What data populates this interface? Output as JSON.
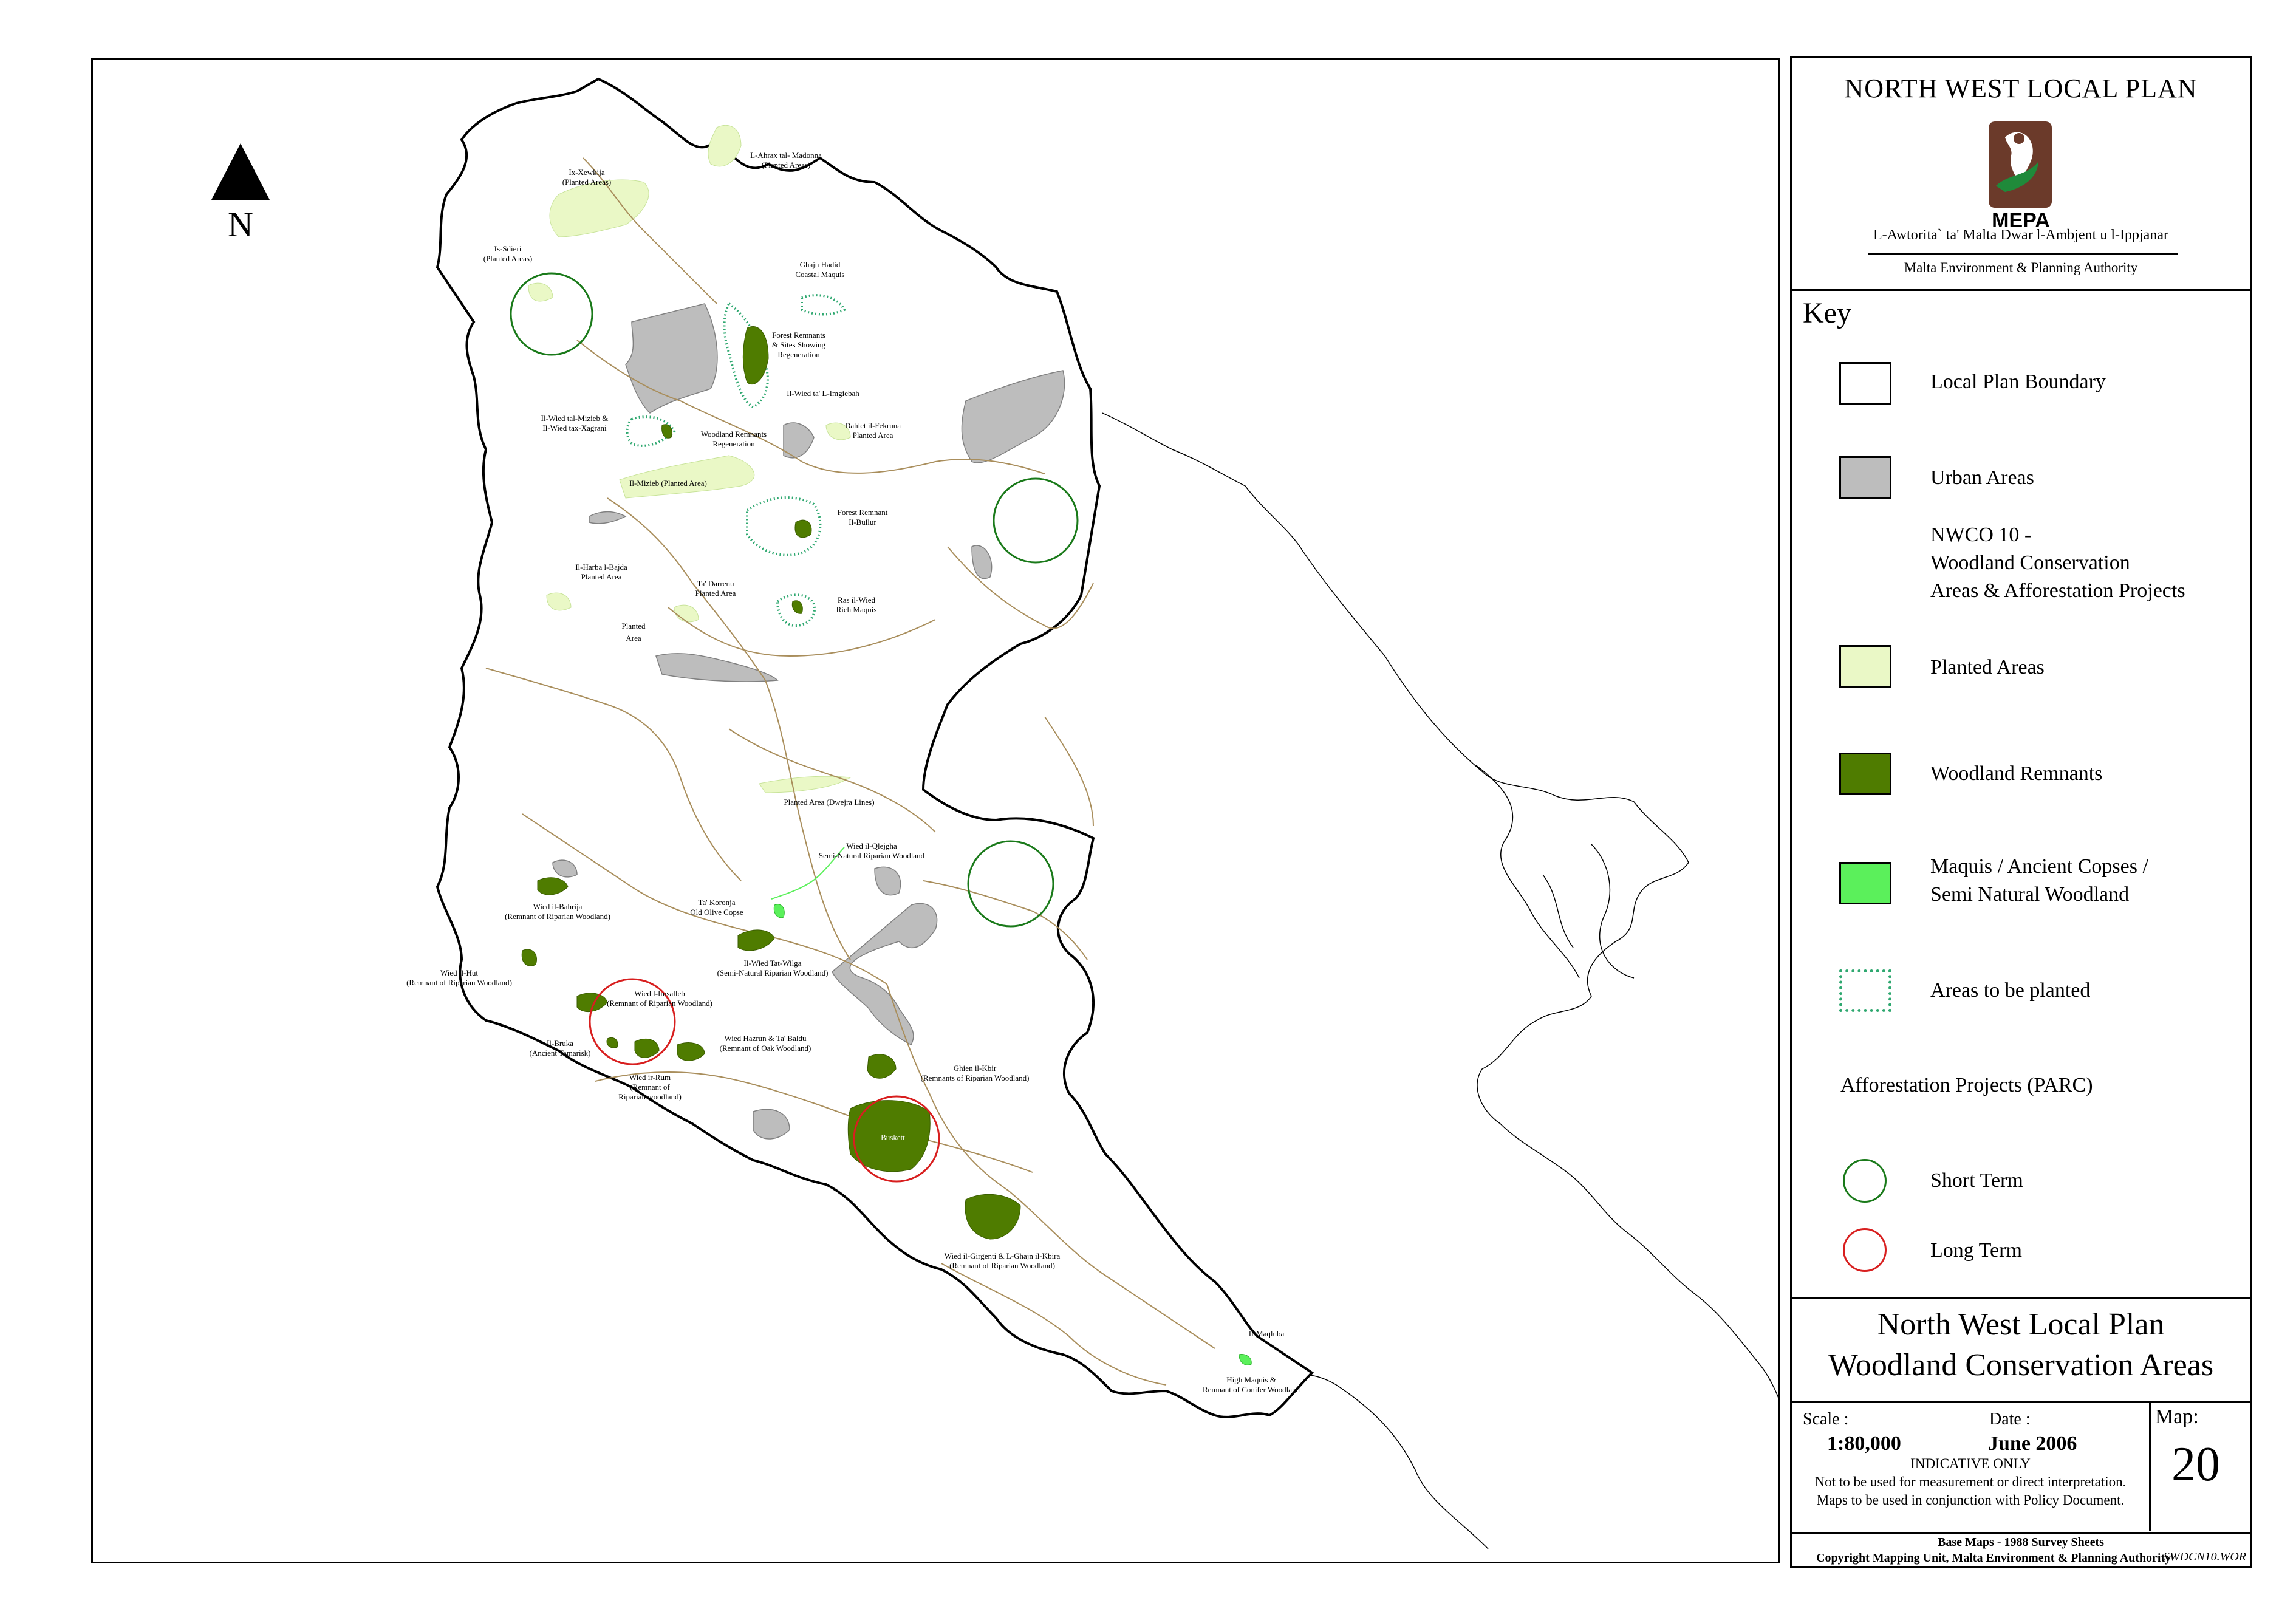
{
  "north_label": "N",
  "header": {
    "title": "NORTH WEST LOCAL PLAN",
    "logo_text": "MEPA",
    "authority_maltese": "L-Awtorita` ta' Malta Dwar l-Ambjent u l-Ippjanar",
    "authority_english": "Malta Environment & Planning Authority"
  },
  "key": {
    "title": "Key",
    "items": [
      {
        "label": "Local Plan Boundary",
        "fill": "#ffffff",
        "border": "#000000",
        "style": "solid"
      },
      {
        "label": "Urban Areas",
        "fill": "#bdbdbd",
        "border": "#000000",
        "style": "solid"
      },
      {
        "label": "NWCO 10 -",
        "fill": "",
        "border": "",
        "style": "none"
      },
      {
        "label": "Woodland Conservation",
        "fill": "",
        "border": "",
        "style": "none"
      },
      {
        "label": "Areas & Afforestation Projects",
        "fill": "",
        "border": "",
        "style": "none"
      },
      {
        "label": "Planted Areas",
        "fill": "#eaf8c6",
        "border": "#000000",
        "style": "solid"
      },
      {
        "label": "Woodland Remnants",
        "fill": "#4f7c00",
        "border": "#000000",
        "style": "solid"
      },
      {
        "label": "Maquis / Ancient Copses /",
        "fill": "#5bf05b",
        "border": "#000000",
        "style": "solid"
      },
      {
        "label": "Semi Natural Woodland",
        "fill": "",
        "border": "",
        "style": "none"
      },
      {
        "label": "Areas to be planted",
        "fill": "#ffffff",
        "border": "#2fa870",
        "style": "dotted"
      }
    ],
    "afforestation_title": "Afforestation Projects (PARC)",
    "short_term": {
      "label": "Short Term",
      "color": "#1a7a1a"
    },
    "long_term": {
      "label": "Long Term",
      "color": "#d81f1f"
    }
  },
  "plan_title": {
    "line1": "North West Local Plan",
    "line2": "Woodland Conservation Areas"
  },
  "info": {
    "scale_label": "Scale :",
    "scale_value": "1:80,000",
    "date_label": "Date :",
    "date_value": "June 2006",
    "map_label": "Map:",
    "map_number": "20",
    "indicative": "INDICATIVE ONLY",
    "note1": "Not to be used for measurement or direct interpretation.",
    "note2": "Maps to be used in conjunction with Policy Document."
  },
  "footer": {
    "base_maps": "Base Maps - 1988 Survey Sheets",
    "copyright": "Copyright Mapping Unit, Malta Environment & Planning Authority",
    "reference": "SWDCN10.WOR"
  },
  "map_labels": [
    {
      "id": "ix-xewkija",
      "lines": [
        "Ix-Xewkija",
        "(Planted Areas)"
      ]
    },
    {
      "id": "l-ahrax",
      "lines": [
        "L-Ahrax tal- Madonna",
        "(Planted Areas)"
      ]
    },
    {
      "id": "is-sdieri",
      "lines": [
        "Is-Sdieri",
        "(Planted Areas)"
      ]
    },
    {
      "id": "ghajn-hadid",
      "lines": [
        "Ghajn Hadid",
        "Coastal Maquis"
      ]
    },
    {
      "id": "forest-remnants",
      "lines": [
        "Forest Remnants",
        "& Sites Showing",
        "Regeneration"
      ]
    },
    {
      "id": "il-wied-ta-l-imgiebah",
      "lines": [
        "Il-Wied ta' L-Imgiebah"
      ]
    },
    {
      "id": "il-wied-tal-mizieb",
      "lines": [
        "Il-Wied tal-Mizieb &",
        "Il-Wied tax-Xagrani"
      ]
    },
    {
      "id": "woodland-remnants-regen",
      "lines": [
        "Woodland Remnants",
        "Regeneration"
      ]
    },
    {
      "id": "dahlet-il-fekruna",
      "lines": [
        "Dahlet il-Fekruna",
        "Planted Area"
      ]
    },
    {
      "id": "il-mizieb",
      "lines": [
        "Il-Mizieb (Planted Area)"
      ]
    },
    {
      "id": "forest-remnant-il-bullur",
      "lines": [
        "Forest Remnant",
        "Il-Bullur"
      ]
    },
    {
      "id": "il-harba",
      "lines": [
        "Il-Harba l-Bajda",
        "Planted Area"
      ]
    },
    {
      "id": "ta-darrenu",
      "lines": [
        "Ta' Darrenu",
        "Planted Area"
      ]
    },
    {
      "id": "ras-il-wied",
      "lines": [
        "Ras il-Wied",
        "Rich Maquis"
      ]
    },
    {
      "id": "planted-area",
      "lines": [
        "Planted",
        "Area"
      ]
    },
    {
      "id": "dwejra-lines",
      "lines": [
        "Planted Area (Dwejra Lines)"
      ]
    },
    {
      "id": "wied-il-qlejgha",
      "lines": [
        "Wied il-Qlejgha",
        "Semi-Natural Riparian Woodland"
      ]
    },
    {
      "id": "wied-il-bahrija",
      "lines": [
        "Wied il-Bahrija",
        "(Remnant of Riparian Woodland)"
      ]
    },
    {
      "id": "ta-koronja",
      "lines": [
        "Ta' Koronja",
        "Old Olive Copse"
      ]
    },
    {
      "id": "il-wied-tat-wilga",
      "lines": [
        "Il-Wied Tat-Wilga",
        "(Semi-Natural Riparian Woodland)"
      ]
    },
    {
      "id": "wied-il-hut",
      "lines": [
        "Wied il-Hut",
        "(Remnant of Riparian Woodland)"
      ]
    },
    {
      "id": "wied-l-imsalleb",
      "lines": [
        "Wied l-Imsalleb",
        "(Remnant of Riparian Woodland)"
      ]
    },
    {
      "id": "il-bruka",
      "lines": [
        "Il-Bruka",
        "(Ancient Tamarisk)"
      ]
    },
    {
      "id": "wied-hazrun",
      "lines": [
        "Wied Hazrun & Ta' Baldu",
        "(Remnant of Oak Woodland)"
      ]
    },
    {
      "id": "ghien-il-kbir",
      "lines": [
        "Ghien il-Kbir",
        "(Remnants of Riparian Woodland)"
      ]
    },
    {
      "id": "wied-ir-rum",
      "lines": [
        "Wied ir-Rum",
        "(Remnant of",
        "Riparian woodland)"
      ]
    },
    {
      "id": "buskett",
      "lines": [
        "Buskett"
      ]
    },
    {
      "id": "wied-il-girgenti",
      "lines": [
        "Wied il-Girgenti & L-Ghajn il-Kbira",
        "(Remnant of Riparian Woodland)"
      ]
    },
    {
      "id": "il-maqluba",
      "lines": [
        "Il-Maqluba"
      ]
    },
    {
      "id": "high-maquis",
      "lines": [
        "High Maquis &",
        "Remnant of Conifer Woodland"
      ]
    }
  ]
}
